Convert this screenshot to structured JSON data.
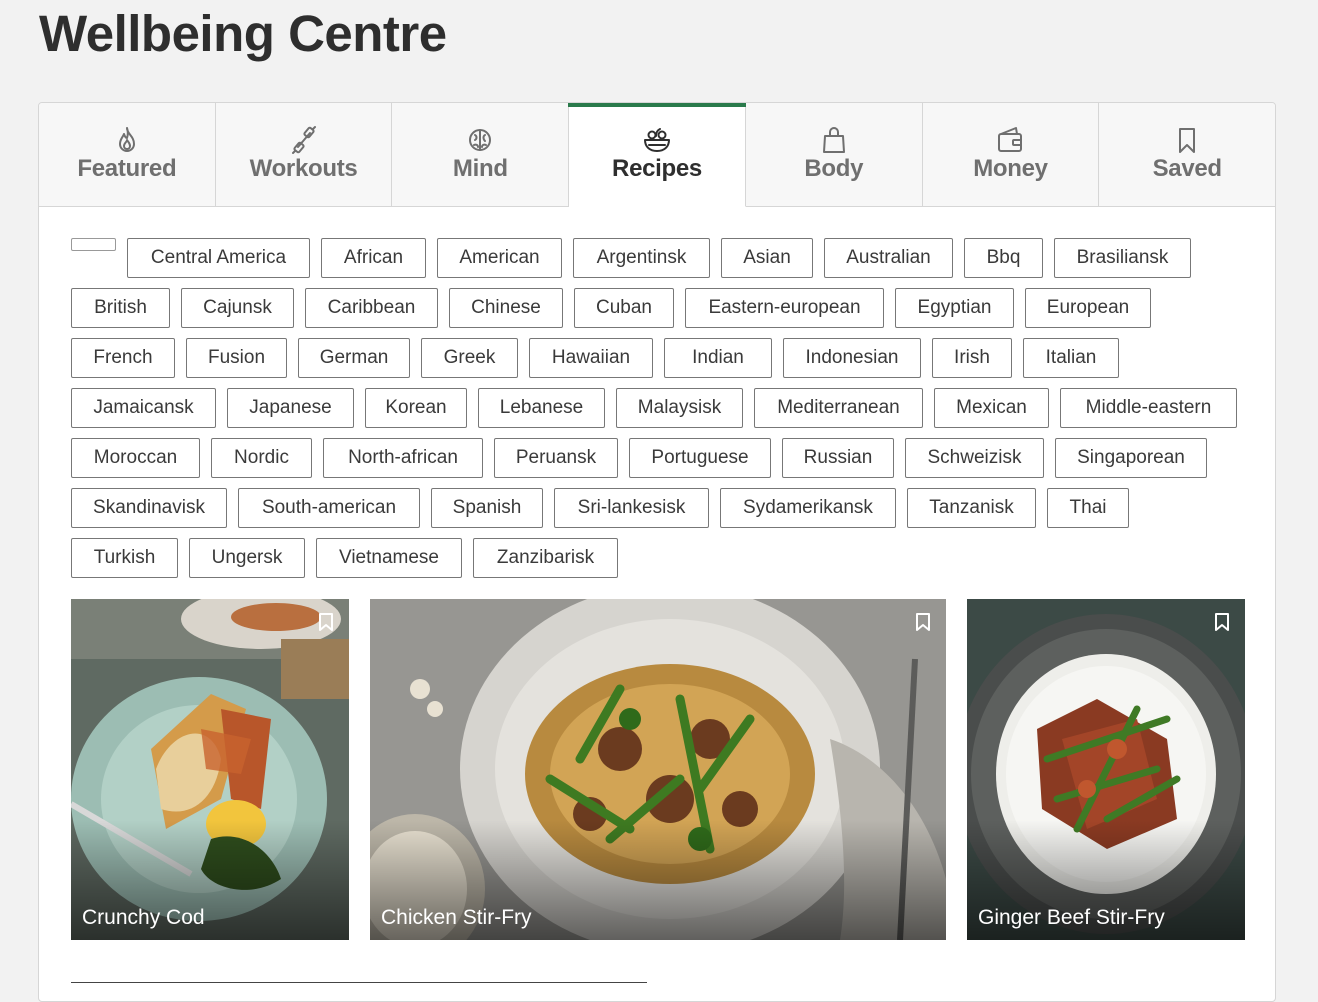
{
  "page": {
    "title": "Wellbeing Centre"
  },
  "tabs": [
    {
      "label": "Featured",
      "icon": "flame-icon"
    },
    {
      "label": "Workouts",
      "icon": "dumbbell-icon"
    },
    {
      "label": "Mind",
      "icon": "brain-icon"
    },
    {
      "label": "Recipes",
      "icon": "salad-bowl-icon",
      "active": true
    },
    {
      "label": "Body",
      "icon": "shopping-bag-icon"
    },
    {
      "label": "Money",
      "icon": "wallet-icon"
    },
    {
      "label": "Saved",
      "icon": "bookmark-icon"
    }
  ],
  "cuisines": [
    [
      "",
      "Central America",
      "African",
      "American",
      "Argentinsk",
      "Asian",
      "Australian",
      "Bbq",
      "Brasiliansk"
    ],
    [
      "British",
      "Cajunsk",
      "Caribbean",
      "Chinese",
      "Cuban",
      "Eastern-european",
      "Egyptian",
      "European"
    ],
    [
      "French",
      "Fusion",
      "German",
      "Greek",
      "Hawaiian",
      "Indian",
      "Indonesian",
      "Irish",
      "Italian"
    ],
    [
      "Jamaicansk",
      "Japanese",
      "Korean",
      "Lebanese",
      "Malaysisk",
      "Mediterranean",
      "Mexican",
      "Middle-eastern"
    ],
    [
      "Moroccan",
      "Nordic",
      "North-african",
      "Peruansk",
      "Portuguese",
      "Russian",
      "Schweizisk",
      "Singaporean"
    ],
    [
      "Skandinavisk",
      "South-american",
      "Spanish",
      "Sri-lankesisk",
      "Sydamerikansk",
      "Tanzanisk",
      "Thai"
    ],
    [
      "Turkish",
      "Ungersk",
      "Vietnamese",
      "Zanzibarisk"
    ]
  ],
  "recipes": [
    {
      "title": "Crunchy Cod"
    },
    {
      "title": "Chicken Stir-Fry"
    },
    {
      "title": "Ginger Beef Stir-Fry"
    }
  ],
  "colors": {
    "accent": "#2a7a4b"
  }
}
